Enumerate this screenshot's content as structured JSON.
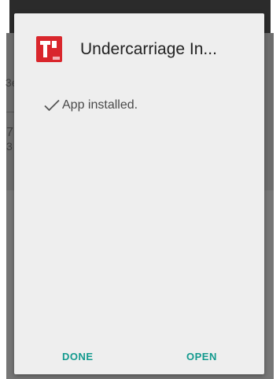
{
  "dialog": {
    "title": "Undercarriage In...",
    "status": "App installed.",
    "done_label": "DONE",
    "open_label": "OPEN"
  },
  "background": {
    "fragment_1": "3e",
    "fragment_2": "7",
    "fragment_3": "3"
  },
  "colors": {
    "accent": "#139a8e",
    "app_icon": "#d9262c",
    "dialog_bg": "#eeeeee"
  },
  "icons": {
    "app": "app-icon",
    "status": "check-icon"
  }
}
